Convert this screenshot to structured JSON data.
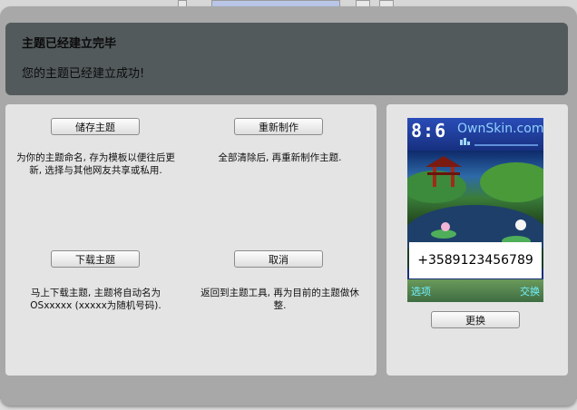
{
  "header": {
    "title": "主题已经建立完毕",
    "subtitle": "您的主题已经建立成功!"
  },
  "actions": [
    {
      "label": "储存主题",
      "desc": "为你的主题命名, 存为模板以便往后更新, 选择与其他网友共享或私用."
    },
    {
      "label": "重新制作",
      "desc": "全部清除后, 再重新制作主题."
    },
    {
      "label": "下载主题",
      "desc": "马上下载主题, 主题将自动名为OSxxxxx (xxxxx为随机号码)."
    },
    {
      "label": "取消",
      "desc": "返回到主题工具, 再为目前的主题做休整."
    }
  ],
  "preview": {
    "clock": "8:6",
    "brand": "OwnSkin.com",
    "phone_number": "+3589123456789",
    "left_softkey": "选项",
    "right_softkey": "交换",
    "button_label": "更换"
  }
}
